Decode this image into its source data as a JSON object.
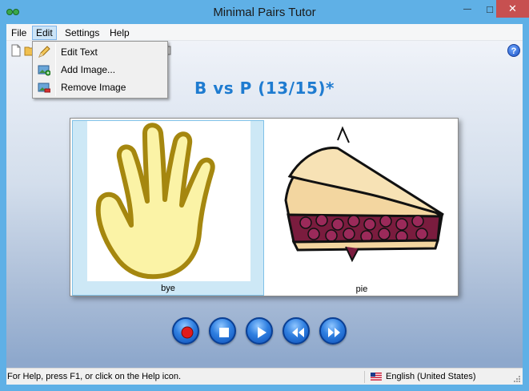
{
  "window": {
    "title": "Minimal Pairs Tutor",
    "close_glyph": "✕",
    "min_glyph": "—",
    "max_glyph": "□"
  },
  "menu": {
    "file": "File",
    "edit": "Edit",
    "settings": "Settings",
    "help": "Help"
  },
  "edit_menu": {
    "items": [
      {
        "label": "Edit Text",
        "icon": "pencil-icon"
      },
      {
        "label": "Add Image...",
        "icon": "add-image-icon"
      },
      {
        "label": "Remove Image",
        "icon": "remove-image-icon"
      }
    ]
  },
  "toolbar": {
    "help_glyph": "?"
  },
  "lesson": {
    "heading": "B vs P (13/15)*"
  },
  "pairs": [
    {
      "caption": "bye",
      "selected": true
    },
    {
      "caption": "pie",
      "selected": false
    }
  ],
  "controls": [
    "record-icon",
    "stop-icon",
    "play-icon",
    "rewind-icon",
    "fast-forward-icon"
  ],
  "status": {
    "text": "For Help, press F1, or click on the Help icon.",
    "language": "English (United States)"
  },
  "colors": {
    "accent": "#1e7bd0",
    "titlebar": "#5fb0e6",
    "close": "#c75050",
    "record": "#e21b1b"
  }
}
